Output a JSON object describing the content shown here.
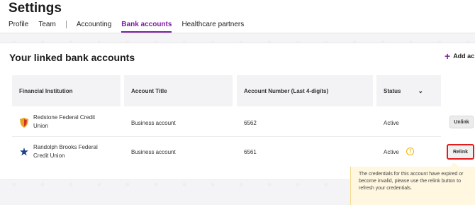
{
  "header": {
    "title": "Settings",
    "tabs": [
      {
        "label": "Profile"
      },
      {
        "label": "Team"
      },
      {
        "label": "Accounting"
      },
      {
        "label": "Bank accounts"
      },
      {
        "label": "Healthcare partners"
      }
    ],
    "active_tab": "Bank accounts"
  },
  "card": {
    "title": "Your linked bank accounts",
    "add_label": "Add ac",
    "columns": [
      "Financial Institution",
      "Account Title",
      "Account Number (Last 4-digits)",
      "Status"
    ],
    "rows": [
      {
        "institution": "Redstone Federal Credit Union",
        "institution_line1": "Redstone Federal Credit",
        "institution_line2": "Union",
        "title": "Business account",
        "number": "6562",
        "status": "Active",
        "action": "Unlink",
        "logo": "shield-logo-icon"
      },
      {
        "institution": "Randolph Brooks Federal Credit Union",
        "institution_line1": "Randolph Brooks Federal",
        "institution_line2": "Credit Union",
        "title": "Business account",
        "number": "6561",
        "status": "Active",
        "action": "Relink",
        "logo": "star-logo-icon",
        "warning": true
      }
    ]
  },
  "tooltip": {
    "text": "The credentials for this account have expired or become invalid, please use the relink button to refresh your credentials."
  },
  "colors": {
    "accent": "#7b1fa2",
    "warning": "#f0b400",
    "highlight": "#e41b1b"
  }
}
